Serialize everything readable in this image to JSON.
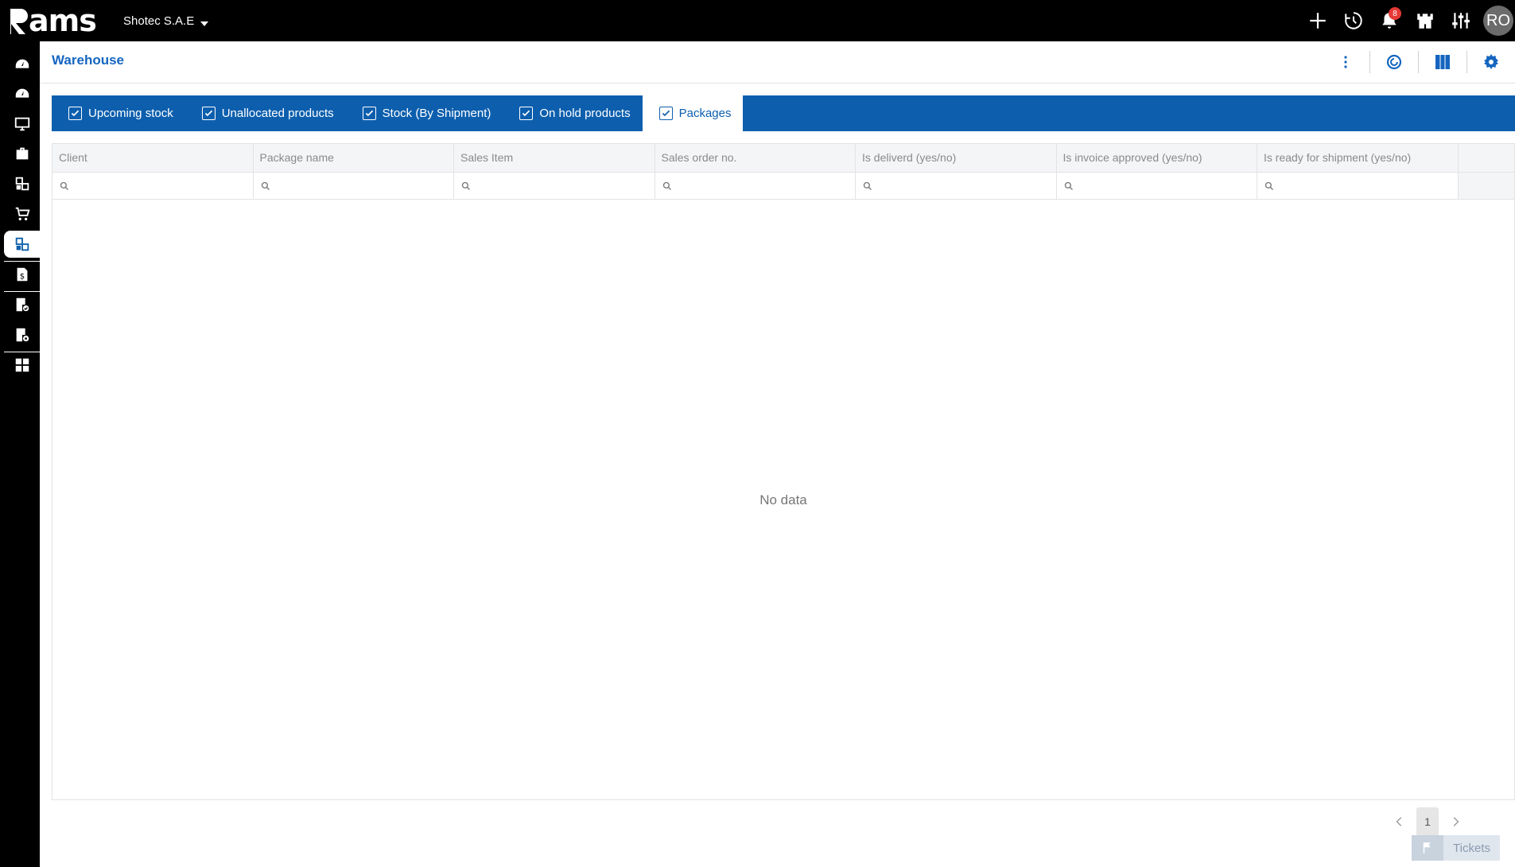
{
  "app": {
    "logo": "ams",
    "company": "Shotec S.A.E",
    "notifications_count": "8",
    "user_initials": "RO"
  },
  "top_icons": [
    "plus-icon",
    "history-icon",
    "bell-icon",
    "castle-icon",
    "sliders-icon"
  ],
  "sidebar": {
    "items": [
      "dashboard-icon",
      "dashboard-alt-icon",
      "monitor-icon",
      "briefcase-icon",
      "warehouse-icon",
      "cart-icon",
      "warehouse-active-icon",
      "invoice-dollar-icon",
      "document-check-icon",
      "document-settings-icon",
      "grid-layout-icon"
    ],
    "active_index": 6
  },
  "page": {
    "title": "Warehouse"
  },
  "tabs": [
    {
      "label": "Upcoming stock",
      "checked": true
    },
    {
      "label": "Unallocated products",
      "checked": true
    },
    {
      "label": "Stock (By Shipment)",
      "checked": true
    },
    {
      "label": "On hold products",
      "checked": true
    },
    {
      "label": "Packages",
      "checked": true,
      "active": true
    }
  ],
  "grid": {
    "columns": [
      "Client",
      "Package name",
      "Sales Item",
      "Sales order no.",
      "Is deliverd (yes/no)",
      "Is invoice approved (yes/no)",
      "Is ready for shipment (yes/no)"
    ],
    "empty_text": "No data"
  },
  "pager": {
    "current_page": "1"
  },
  "tickets": {
    "label": "Tickets"
  },
  "colors": {
    "accent": "#0d5fae",
    "title": "#1565c0",
    "badge": "#e53935"
  }
}
